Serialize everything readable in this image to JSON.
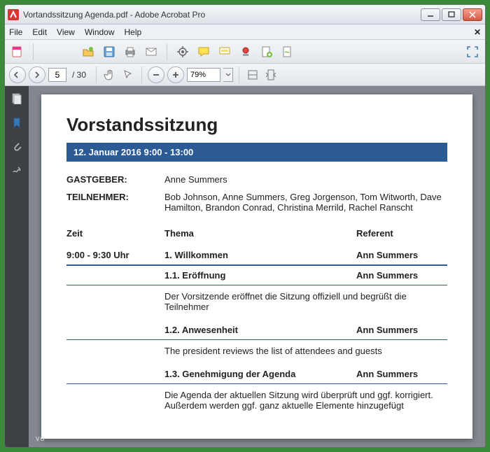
{
  "titlebar": {
    "title": "Vortandssitzung Agenda.pdf - Adobe Acrobat Pro"
  },
  "menu": {
    "file": "File",
    "edit": "Edit",
    "view": "View",
    "window": "Window",
    "help": "Help"
  },
  "nav": {
    "page_current": "5",
    "page_total": "/ 30",
    "zoom": "79%"
  },
  "doc": {
    "title": "Vorstandssitzung",
    "date_line": "12. Januar 2016 9:00 - 13:00",
    "host_label": "GASTGEBER:",
    "host_value": "Anne Summers",
    "attendees_label": "TEILNEHMER:",
    "attendees_value": "Bob Johnson, Anne Summers, Greg Jorgenson, Tom Witworth, Dave Hamilton, Brandon Conrad, Christina Merrild, Rachel Ranscht",
    "hdr_time": "Zeit",
    "hdr_topic": "Thema",
    "hdr_ref": "Referent",
    "row1_time": "9:00 - 9:30 Uhr",
    "row1_topic": "1. Willkommen",
    "row1_ref": "Ann Summers",
    "row2_topic": "1.1. Eröffnung",
    "row2_ref": "Ann Summers",
    "row2_desc": "Der Vorsitzende eröffnet die Sitzung offiziell und begrüßt die Teilnehmer",
    "row3_topic": "1.2. Anwesenheit",
    "row3_ref": "Ann Summers",
    "row3_desc": "The president reviews the list of attendees and guests",
    "row4_topic": "1.3. Genehmigung der Agenda",
    "row4_ref": "Ann Summers",
    "row4_desc": "Die Agenda der aktuellen Sitzung wird überprüft und ggf. korrigiert. Außerdem werden ggf. ganz aktuelle Elemente hinzugefügt"
  },
  "watermark": "vo"
}
